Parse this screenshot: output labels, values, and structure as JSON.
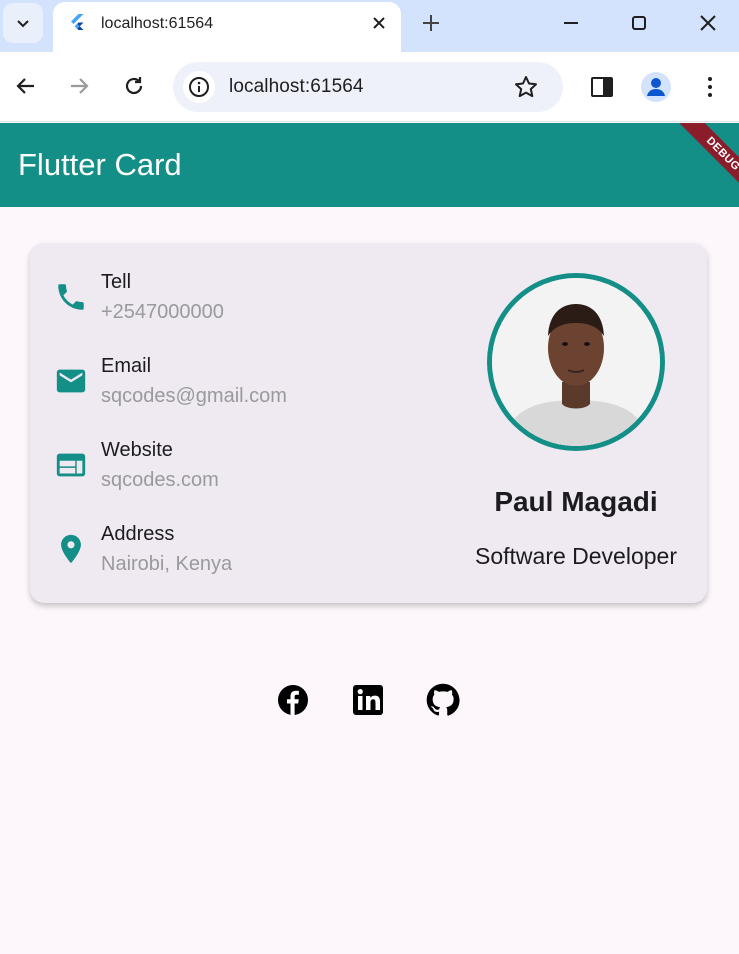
{
  "browser": {
    "tab_title": "localhost:61564",
    "url": "localhost:61564"
  },
  "app": {
    "title": "Flutter Card",
    "debug_banner": "DEBUG"
  },
  "contact": [
    {
      "label": "Tell",
      "value": "+2547000000",
      "icon": "phone-icon"
    },
    {
      "label": "Email",
      "value": "sqcodes@gmail.com",
      "icon": "mail-icon"
    },
    {
      "label": "Website",
      "value": "sqcodes.com",
      "icon": "web-icon"
    },
    {
      "label": "Address",
      "value": "Nairobi, Kenya",
      "icon": "location-pin-icon"
    }
  ],
  "profile": {
    "name": "Paul Magadi",
    "role": "Software Developer"
  },
  "social": [
    "facebook-icon",
    "linkedin-icon",
    "github-icon"
  ],
  "colors": {
    "primary": "#138f87",
    "card": "#efe9f2",
    "background": "#fdf7fb",
    "debug_banner": "#8b1c2a"
  }
}
